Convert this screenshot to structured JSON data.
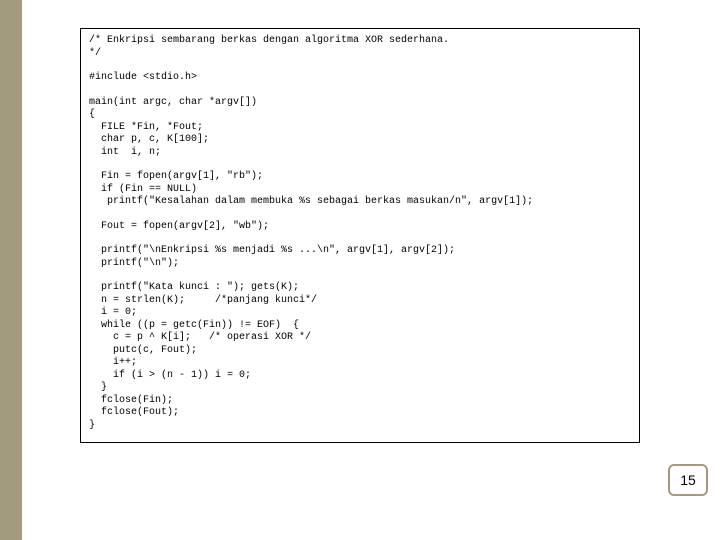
{
  "page_number": "15",
  "code": {
    "l1": "/* Enkripsi sembarang berkas dengan algoritma XOR sederhana.",
    "l2": "*/",
    "l3": "#include <stdio.h>",
    "l4": "main(int argc, char *argv[])",
    "l5": "{",
    "l6": "  FILE *Fin, *Fout;",
    "l7": "  char p, c, K[100];",
    "l8": "  int  i, n;",
    "l9": "  Fin = fopen(argv[1], \"rb\");",
    "l10": "  if (Fin == NULL)",
    "l11": "   printf(\"Kesalahan dalam membuka %s sebagai berkas masukan/n\", argv[1]);",
    "l12": "  Fout = fopen(argv[2], \"wb\");",
    "l13": "  printf(\"\\nEnkripsi %s menjadi %s ...\\n\", argv[1], argv[2]);",
    "l14": "  printf(\"\\n\");",
    "l15": "  printf(\"Kata kunci : \"); gets(K);",
    "l16": "  n = strlen(K);     /*panjang kunci*/",
    "l17": "  i = 0;",
    "l18": "  while ((p = getc(Fin)) != EOF)  {",
    "l19": "    c = p ^ K[i];   /* operasi XOR */",
    "l20": "    putc(c, Fout);",
    "l21": "    i++;",
    "l22": "    if (i > (n - 1)) i = 0;",
    "l23": "  }",
    "l24": "  fclose(Fin);",
    "l25": "  fclose(Fout);",
    "l26": "}"
  }
}
